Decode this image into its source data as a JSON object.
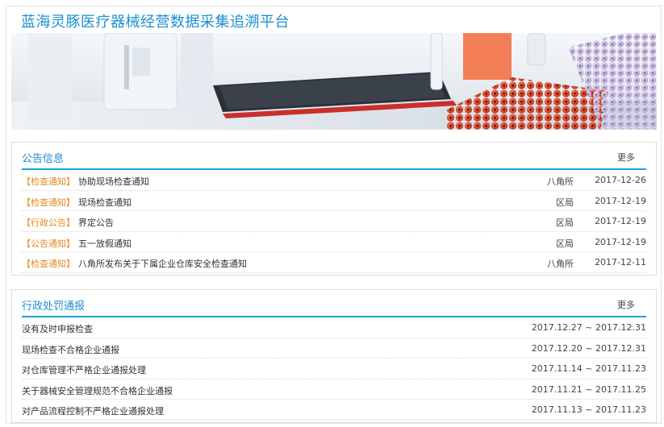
{
  "site": {
    "title": "蓝海灵豚医疗器械经营数据采集追溯平台"
  },
  "notices": {
    "title": "公告信息",
    "more": "更多",
    "items": [
      {
        "tag": "【检查通知】",
        "title": "协助现场检查通知",
        "dept": "八角所",
        "date": "2017-12-26"
      },
      {
        "tag": "【检查通知】",
        "title": "现场检查通知",
        "dept": "区局",
        "date": "2017-12-19"
      },
      {
        "tag": "【行政公告】",
        "title": "界定公告",
        "dept": "区局",
        "date": "2017-12-19"
      },
      {
        "tag": "【公告通知】",
        "title": "五一放假通知",
        "dept": "区局",
        "date": "2017-12-19"
      },
      {
        "tag": "【检查通知】",
        "title": "八角所发布关于下属企业仓库安全检查通知",
        "dept": "八角所",
        "date": "2017-12-11"
      }
    ]
  },
  "penalties": {
    "title": "行政处罚通报",
    "more": "更多",
    "items": [
      {
        "title": "没有及时申报检查",
        "period": "2017.12.27 ~ 2017.12.31"
      },
      {
        "title": "现场检查不合格企业通报",
        "period": "2017.12.20 ~ 2017.12.31"
      },
      {
        "title": "对仓库管理不严格企业通报处理",
        "period": "2017.11.14 ~ 2017.11.23"
      },
      {
        "title": "关于器械安全管理规范不合格企业通报",
        "period": "2017.11.21 ~ 2017.11.25"
      },
      {
        "title": "对产品流程控制不严格企业通报处理",
        "period": "2017.11.13 ~ 2017.11.23"
      }
    ]
  },
  "colors": {
    "accent": "#1a8fd1",
    "tag": "#e8891e",
    "rule": "#1aa3e0"
  }
}
